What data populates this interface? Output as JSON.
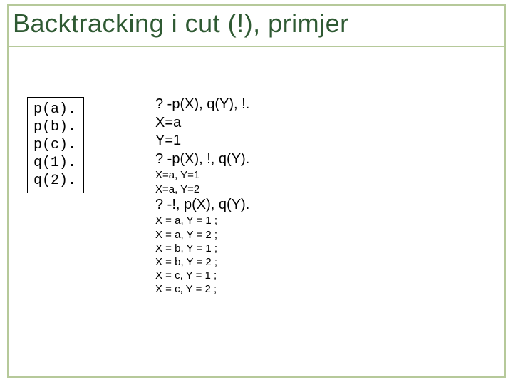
{
  "title": "Backtracking i cut (!), primjer",
  "facts": {
    "l1": "p(a).",
    "l2": "p(b).",
    "l3": "p(c).",
    "l4": "q(1).",
    "l5": "q(2)."
  },
  "results": {
    "q1": "? -p(X), q(Y), !.",
    "a1": "X=a",
    "a2": "Y=1",
    "q2": "? -p(X), !, q(Y).",
    "s1": "X=a, Y=1",
    "s2": "X=a, Y=2",
    "q3": "? -!, p(X), q(Y).",
    "r1": "X = a, Y = 1 ;",
    "r2": "X = a, Y = 2 ;",
    "r3": "X = b, Y = 1 ;",
    "r4": "X = b, Y = 2 ;",
    "r5": "X = c, Y = 1 ;",
    "r6": "X = c, Y = 2 ;"
  }
}
